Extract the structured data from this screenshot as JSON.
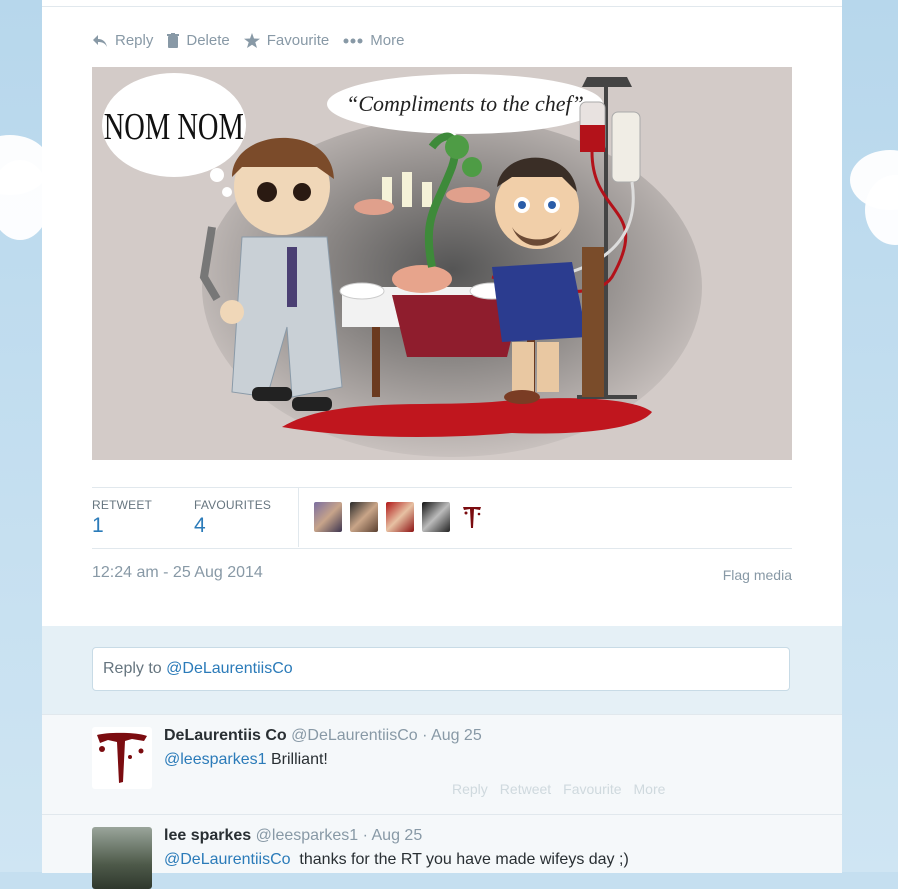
{
  "actions": {
    "reply": "Reply",
    "delete": "Delete",
    "favourite": "Favourite",
    "more": "More"
  },
  "media": {
    "bubble_left": "NOM NOM",
    "bubble_right": "“Compliments to the chef”"
  },
  "stats": {
    "retweet_label": "RETWEET",
    "retweet_count": "1",
    "favourites_label": "FAVOURITES",
    "favourites_count": "4"
  },
  "timestamp": "12:24 am - 25 Aug 2014",
  "flag_media": "Flag media",
  "reply_box": {
    "prefix": "Reply to ",
    "mention": "@DeLaurentiisCo"
  },
  "replies": [
    {
      "name": "DeLaurentiis Co",
      "handle": "@DeLaurentiisCo",
      "time": "· Aug 25",
      "mention": "@leesparkes1",
      "text": " Brilliant!",
      "actions": [
        "Reply",
        "Retweet",
        "Favourite",
        "More"
      ]
    },
    {
      "name": "lee sparkes",
      "handle": "@leesparkes1",
      "time": "· Aug 25",
      "mention": "@DeLaurentiisCo",
      "text": "  thanks for the RT you have made wifeys day ;)"
    }
  ],
  "colors": {
    "link": "#2b7bb9",
    "muted": "#8899a6",
    "background": "#c5dff0"
  }
}
